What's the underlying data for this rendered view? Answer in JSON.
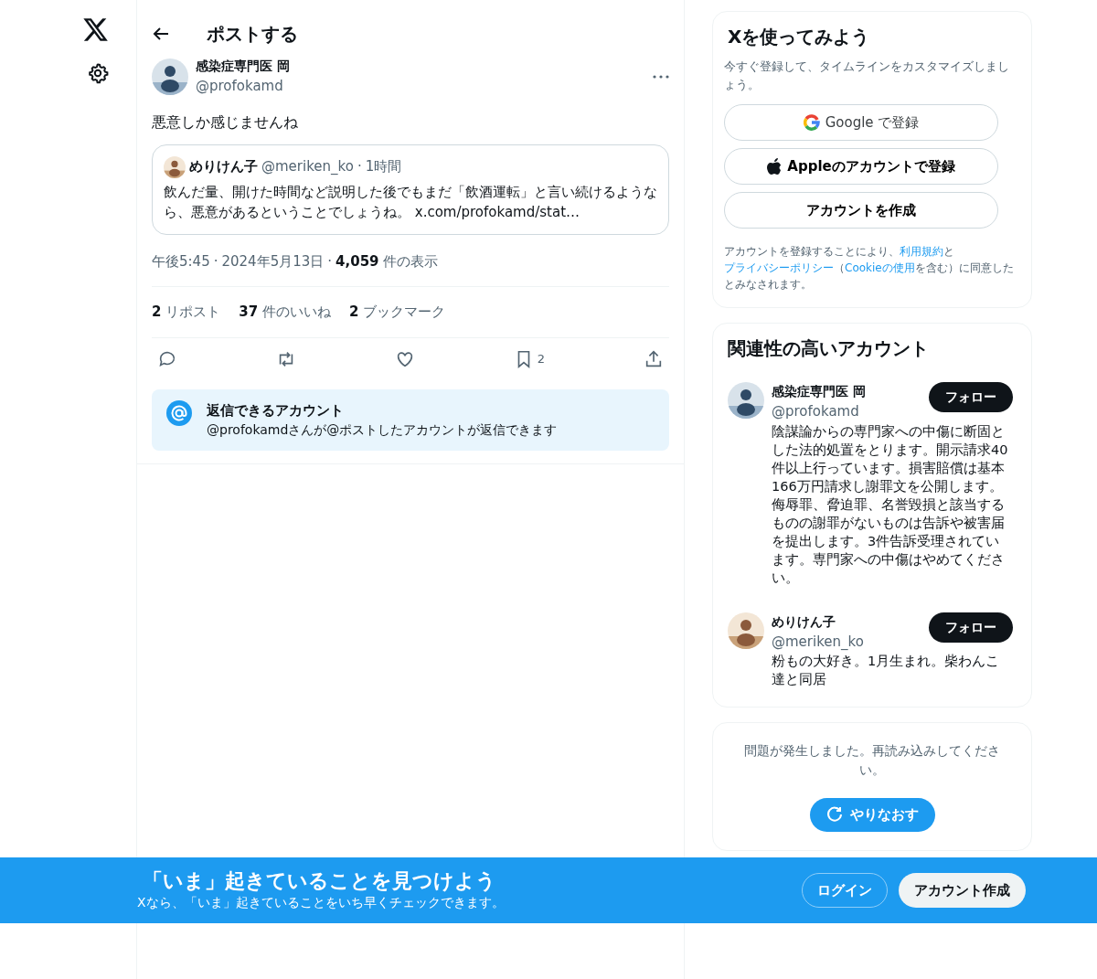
{
  "header": {
    "title": "ポストする"
  },
  "post": {
    "author": "感染症専門医 岡",
    "handle": "@profokamd",
    "text": "悪意しか感じませんね",
    "quote": {
      "author": "めりけん子",
      "handle": "@meriken_ko",
      "time": "1時間",
      "text": "飲んだ量、開けた時間など説明した後でもまだ「飲酒運転」と言い続けるようなら、悪意があるということでしょうね。 x.com/profokamd/stat…"
    },
    "separator": "·",
    "time": "午後5:45",
    "date": "2024年5月13日",
    "views": "4,059",
    "views_label": "件の表示",
    "stats": [
      {
        "count": "2",
        "label": "リポスト"
      },
      {
        "count": "37",
        "label": "件のいいね"
      },
      {
        "count": "2",
        "label": "ブックマーク"
      }
    ],
    "actions": [
      {
        "kind": "reply"
      },
      {
        "kind": "repost"
      },
      {
        "kind": "like"
      },
      {
        "kind": "bookmark",
        "count": "2"
      },
      {
        "kind": "share"
      }
    ],
    "reply_notice": {
      "title": "返信できるアカウント",
      "text": "@profokamdさんが@ポストしたアカウントが返信できます"
    }
  },
  "signup": {
    "title": "Xを使ってみよう",
    "subtitle": "今すぐ登録して、タイムラインをカスタマイズしましょう。",
    "buttons": [
      {
        "kind": "google",
        "label": "Google で登録"
      },
      {
        "kind": "apple",
        "label": "Appleのアカウントで登録"
      },
      {
        "kind": "create",
        "label": "アカウントを作成"
      }
    ],
    "legal": "アカウントを登録することにより、",
    "terms": "利用規約",
    "and": "と",
    "privacy": "プライバシーポリシー",
    "paren_open": "（",
    "cookie": "Cookieの使用",
    "legal_end": "を含む）に同意したとみなされます。"
  },
  "related": {
    "title": "関連性の高いアカウント",
    "accounts": [
      {
        "name": "感染症専門医 岡",
        "handle": "@profokamd",
        "follow": "フォロー",
        "bio": "陰謀論からの専門家への中傷に断固とした法的処置をとります。開示請求40件以上行っています。損害賠償は基本166万円請求し謝罪文を公開します。侮辱罪、脅迫罪、名誉毀損と該当するものの謝罪がないものは告訴や被害届を提出します。3件告訴受理されています。専門家への中傷はやめてください。"
      },
      {
        "name": "めりけん子",
        "handle": "@meriken_ko",
        "follow": "フォロー",
        "bio": "粉もの大好き。1月生まれ。柴わんこ達と同居"
      }
    ]
  },
  "error_card": {
    "message": "問題が発生しました。再読み込みしてください。",
    "retry": "やりなおす"
  },
  "banner": {
    "title": "「いま」起きていることを見つけよう",
    "subtitle": "Xなら、「いま」起きていることをいち早くチェックできます。",
    "login": "ログイン",
    "signup": "アカウント作成"
  }
}
